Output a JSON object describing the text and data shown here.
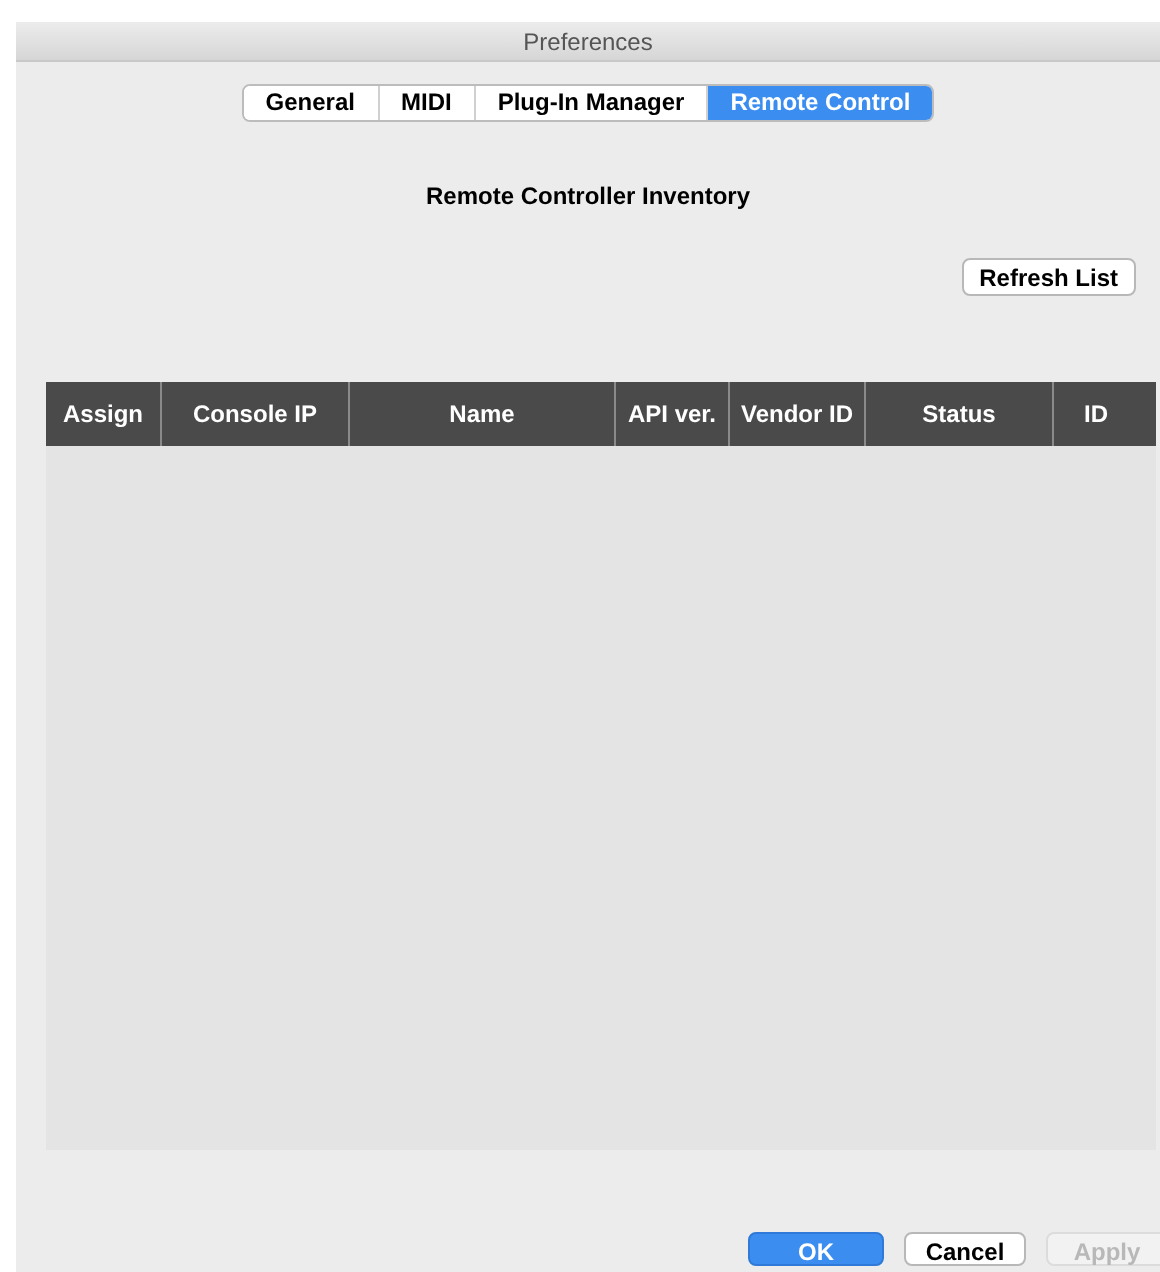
{
  "window": {
    "title": "Preferences"
  },
  "tabs": [
    {
      "label": "General",
      "selected": false
    },
    {
      "label": "MIDI",
      "selected": false
    },
    {
      "label": "Plug-In Manager",
      "selected": false
    },
    {
      "label": "Remote Control",
      "selected": true
    }
  ],
  "heading": "Remote Controller Inventory",
  "refresh_button": "Refresh List",
  "table": {
    "columns": [
      "Assign",
      "Console IP",
      "Name",
      "API ver.",
      "Vendor ID",
      "Status",
      "ID"
    ]
  },
  "buttons": [
    {
      "label": "OK",
      "kind": "default",
      "disabled": false
    },
    {
      "label": "Cancel",
      "kind": "normal",
      "disabled": false
    },
    {
      "label": "Apply",
      "kind": "normal",
      "disabled": true
    }
  ]
}
